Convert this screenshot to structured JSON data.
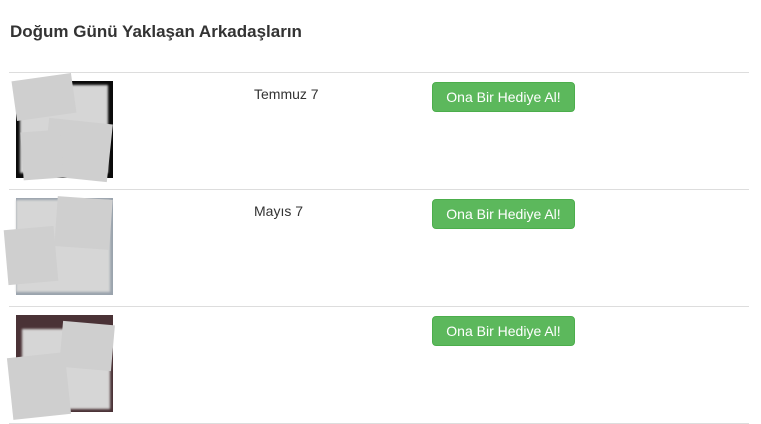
{
  "page": {
    "title": "Doğum Günü Yaklaşan Arkadaşların"
  },
  "friends": [
    {
      "birthday": "Temmuz 7",
      "gift_button": "Ona Bir Hediye Al!"
    },
    {
      "birthday": "Mayıs 7",
      "gift_button": "Ona Bir Hediye Al!"
    },
    {
      "birthday": "",
      "gift_button": "Ona Bir Hediye Al!"
    }
  ],
  "colors": {
    "button_bg": "#5cb85c",
    "button_border": "#4cae4c",
    "divider": "#dddddd",
    "text": "#333333"
  }
}
